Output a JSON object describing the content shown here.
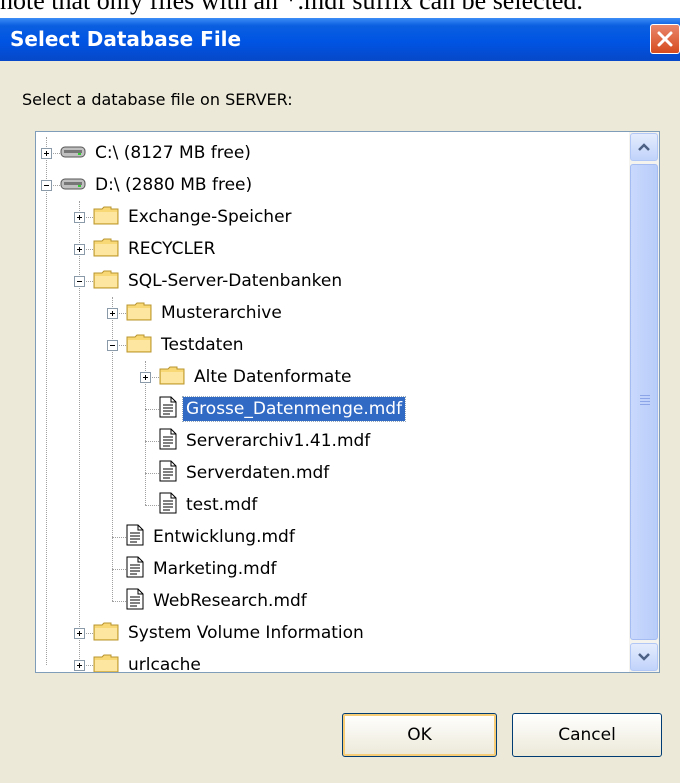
{
  "caption_fragment": "note that only files with an *.mdf suffix can be selected.",
  "dialog": {
    "title": "Select Database File",
    "prompt": "Select a database file on SERVER:",
    "ok_label": "OK",
    "cancel_label": "Cancel"
  },
  "colors": {
    "titlebar": "#0054e3",
    "selection": "#316ac5",
    "dialog_bg": "#ece9d8"
  },
  "tree": [
    {
      "label": "C:\\ (8127 MB free)",
      "icon": "drive-icon",
      "expander": "plus"
    },
    {
      "label": "D:\\ (2880 MB free)",
      "icon": "drive-icon",
      "expander": "minus"
    },
    {
      "label": "Exchange-Speicher",
      "icon": "folder-icon",
      "expander": "plus"
    },
    {
      "label": "RECYCLER",
      "icon": "folder-icon",
      "expander": "plus"
    },
    {
      "label": "SQL-Server-Datenbanken",
      "icon": "folder-icon",
      "expander": "minus"
    },
    {
      "label": "Musterarchive",
      "icon": "folder-icon",
      "expander": "plus"
    },
    {
      "label": "Testdaten",
      "icon": "folder-icon",
      "expander": "minus"
    },
    {
      "label": "Alte Datenformate",
      "icon": "folder-icon",
      "expander": "plus"
    },
    {
      "label": "Grosse_Datenmenge.mdf",
      "icon": "file-icon",
      "selected": true
    },
    {
      "label": "Serverarchiv1.41.mdf",
      "icon": "file-icon"
    },
    {
      "label": "Serverdaten.mdf",
      "icon": "file-icon"
    },
    {
      "label": "test.mdf",
      "icon": "file-icon"
    },
    {
      "label": "Entwicklung.mdf",
      "icon": "file-icon"
    },
    {
      "label": "Marketing.mdf",
      "icon": "file-icon"
    },
    {
      "label": "WebResearch.mdf",
      "icon": "file-icon"
    },
    {
      "label": "System Volume Information",
      "icon": "folder-icon",
      "expander": "plus"
    },
    {
      "label": "urlcache",
      "icon": "folder-icon",
      "expander": "plus"
    }
  ]
}
